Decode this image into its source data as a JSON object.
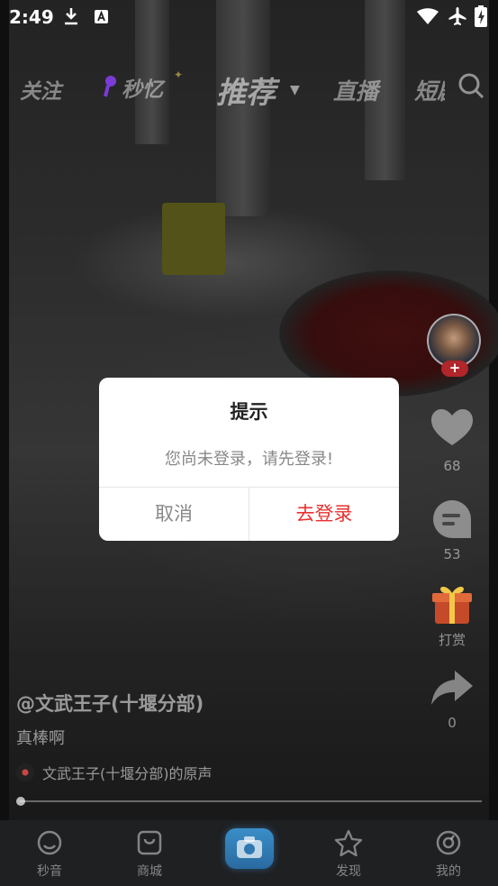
{
  "status_bar": {
    "time": "2:49",
    "icons": [
      "download-icon",
      "a-badge-icon",
      "wifi-icon",
      "airplane-icon",
      "battery-charging-icon"
    ]
  },
  "top_nav": {
    "tabs": [
      {
        "label": "关注"
      },
      {
        "label": "秒忆"
      },
      {
        "label": "推荐",
        "selected": true
      },
      {
        "label": "直播"
      },
      {
        "label": "短剧"
      }
    ]
  },
  "side_actions": {
    "like_count": "68",
    "comment_count": "53",
    "gift_label": "打赏",
    "share_count": "0"
  },
  "video_info": {
    "author": "@文武王子(十堰分部)",
    "description": "真棒啊",
    "music": "文武王子(十堰分部)的原声",
    "progress": 0
  },
  "bottom_tabs": [
    {
      "label": "秒音",
      "icon": "home-icon"
    },
    {
      "label": "商城",
      "icon": "shop-icon"
    },
    {
      "label": "",
      "icon": "camera-icon"
    },
    {
      "label": "发现",
      "icon": "star-icon"
    },
    {
      "label": "我的",
      "icon": "profile-icon"
    }
  ],
  "dialog": {
    "title": "提示",
    "message": "您尚未登录，请先登录!",
    "cancel_label": "取消",
    "confirm_label": "去登录"
  },
  "colors": {
    "accent_red": "#e8312f",
    "camera_blue": "#2a6aa0"
  }
}
